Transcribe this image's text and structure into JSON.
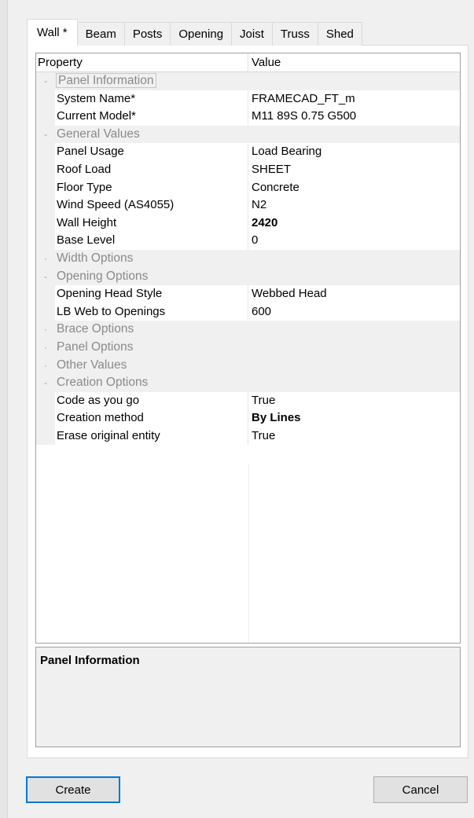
{
  "tabs": [
    "Wall *",
    "Beam",
    "Posts",
    "Opening",
    "Joist",
    "Truss",
    "Shed"
  ],
  "grid": {
    "header_property": "Property",
    "header_value": "Value",
    "rows": [
      {
        "type": "cat",
        "expanded": true,
        "label": "Panel Information"
      },
      {
        "type": "prop",
        "label": "System Name*",
        "value": "FRAMECAD_FT_m",
        "bold": false
      },
      {
        "type": "prop",
        "label": "Current Model*",
        "value": "M11 89S 0.75 G500",
        "bold": false
      },
      {
        "type": "cat",
        "expanded": true,
        "label": "General Values"
      },
      {
        "type": "prop",
        "label": "Panel Usage",
        "value": "Load Bearing",
        "bold": false
      },
      {
        "type": "prop",
        "label": "Roof Load",
        "value": "SHEET",
        "bold": false
      },
      {
        "type": "prop",
        "label": "Floor Type",
        "value": "Concrete",
        "bold": false
      },
      {
        "type": "prop",
        "label": "Wind Speed (AS4055)",
        "value": "N2",
        "bold": false
      },
      {
        "type": "prop",
        "label": "Wall Height",
        "value": "2420",
        "bold": true
      },
      {
        "type": "prop",
        "label": "Base Level",
        "value": "0",
        "bold": false
      },
      {
        "type": "cat",
        "expanded": false,
        "label": "Width Options"
      },
      {
        "type": "cat",
        "expanded": true,
        "label": "Opening Options"
      },
      {
        "type": "prop",
        "label": "Opening Head Style",
        "value": "Webbed Head",
        "bold": false
      },
      {
        "type": "prop",
        "label": "LB Web to Openings",
        "value": "600",
        "bold": false
      },
      {
        "type": "cat",
        "expanded": false,
        "label": "Brace Options"
      },
      {
        "type": "cat",
        "expanded": false,
        "label": "Panel Options"
      },
      {
        "type": "cat",
        "expanded": false,
        "label": "Other Values"
      },
      {
        "type": "cat",
        "expanded": true,
        "label": "Creation Options"
      },
      {
        "type": "prop",
        "label": "Code as you go",
        "value": "True",
        "bold": false
      },
      {
        "type": "prop",
        "label": "Creation method",
        "value": "By Lines",
        "bold": true
      },
      {
        "type": "prop",
        "label": "Erase original entity",
        "value": "True",
        "bold": false
      }
    ]
  },
  "description": {
    "title": "Panel Information"
  },
  "buttons": {
    "create": "Create",
    "cancel": "Cancel"
  }
}
